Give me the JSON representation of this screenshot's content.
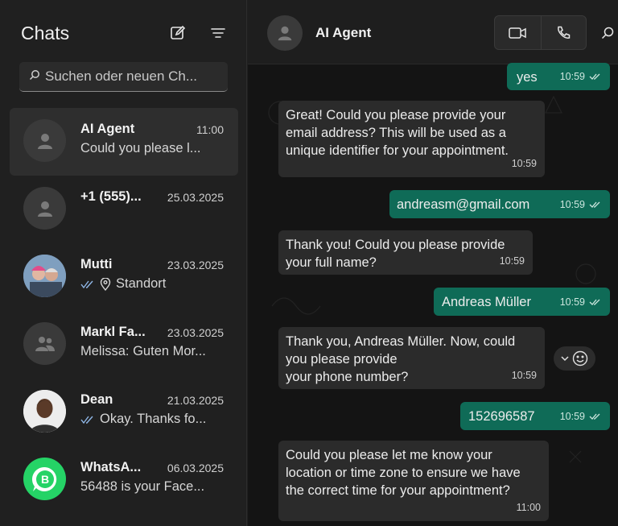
{
  "sidebar": {
    "title": "Chats",
    "search_placeholder": "Suchen oder neuen Ch...",
    "chats": [
      {
        "name": "AI Agent",
        "time": "11:00",
        "preview": "Could you please l..."
      },
      {
        "name": "+1 (555)...",
        "time": "25.03.2025",
        "preview": ""
      },
      {
        "name": "Mutti",
        "time": "23.03.2025",
        "preview": "Standort"
      },
      {
        "name": "Markl Fa...",
        "time": "23.03.2025",
        "preview": "Melissa: Guten Mor..."
      },
      {
        "name": "Dean",
        "time": "21.03.2025",
        "preview": "Okay. Thanks fo..."
      },
      {
        "name": "WhatsA...",
        "time": "06.03.2025",
        "preview": "56488 is your Face..."
      }
    ]
  },
  "conversation": {
    "title": "AI Agent",
    "messages": [
      {
        "dir": "out",
        "text": "yes",
        "time": "10:59"
      },
      {
        "dir": "in",
        "text": "Great! Could you please provide your\nemail address? This will be used as a\nunique identifier for your appointment.",
        "time": "10:59"
      },
      {
        "dir": "out",
        "text": "andreasm@gmail.com",
        "time": "10:59"
      },
      {
        "dir": "in",
        "text": "Thank you! Could you please provide\nyour full name?",
        "time": "10:59"
      },
      {
        "dir": "out",
        "text": "Andreas Müller",
        "time": "10:59"
      },
      {
        "dir": "in",
        "text": "Thank you, Andreas Müller. Now, could\nyou please provide\nyour phone number?",
        "time": "10:59"
      },
      {
        "dir": "out",
        "text": "152696587",
        "time": "10:59"
      },
      {
        "dir": "in",
        "text": "Could you please let me know your\nlocation or time zone to ensure we have\nthe correct time for your appointment?",
        "time": "11:00"
      }
    ]
  },
  "colors": {
    "outgoing_bubble": "#0f6b57",
    "incoming_bubble": "#2b2b2b",
    "read_ticks": "#8fb6e6",
    "whatsapp_green": "#25d366"
  }
}
